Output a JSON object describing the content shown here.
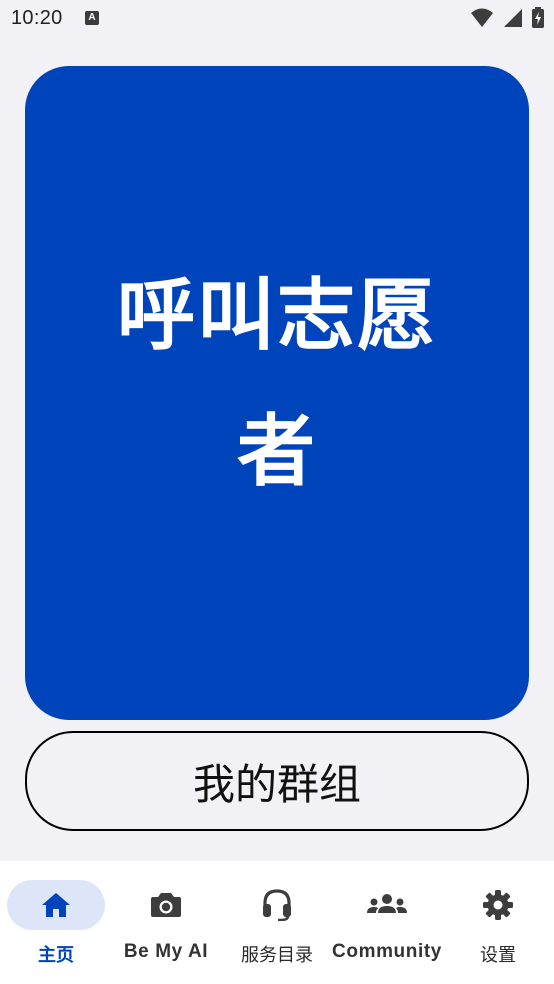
{
  "status_bar": {
    "time": "10:20",
    "notification_icon": "A",
    "icons": [
      "wifi-icon",
      "signal-icon",
      "battery-charging-icon"
    ]
  },
  "main": {
    "call_volunteer_label": "呼叫志愿者",
    "my_groups_label": "我的群组"
  },
  "bottom_nav": {
    "items": [
      {
        "label": "主页",
        "icon": "home-icon",
        "active": true
      },
      {
        "label": "Be My AI",
        "icon": "camera-icon",
        "active": false
      },
      {
        "label": "服务目录",
        "icon": "headset-icon",
        "active": false
      },
      {
        "label": "Community",
        "icon": "groups-icon",
        "active": false
      },
      {
        "label": "设置",
        "icon": "gear-icon",
        "active": false
      }
    ]
  },
  "colors": {
    "primary": "#0044bb",
    "background": "#f2f1f6",
    "nav_active_bg": "#dde6f8"
  }
}
